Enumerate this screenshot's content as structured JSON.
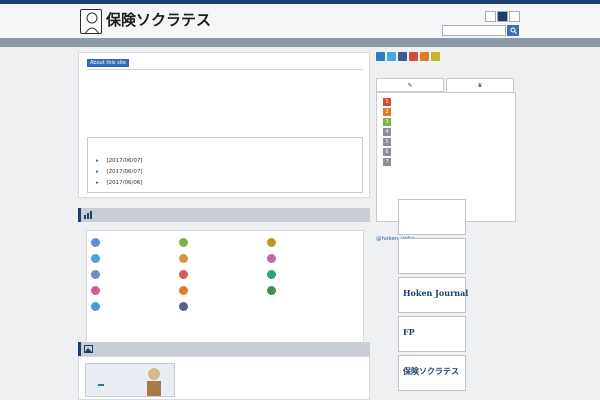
{
  "header": {
    "site_title": "保険ソクラテス",
    "tagline": "",
    "font_size_label": "",
    "font_sizes": [
      "",
      "",
      ""
    ],
    "search_placeholder": ""
  },
  "intro": {
    "badge": "About this site",
    "title": "",
    "paragraph1": "",
    "paragraph2": ""
  },
  "news": {
    "heading": "",
    "items": [
      {
        "category": "",
        "title": "",
        "date": "[2017/06/07]"
      },
      {
        "category": "",
        "title": "",
        "date": "[2017/06/07]"
      },
      {
        "category": "",
        "title": "",
        "date": "[2017/06/06]"
      }
    ]
  },
  "categories": {
    "heading": "",
    "items": [
      {
        "label": "",
        "color": "#5b8fd6"
      },
      {
        "label": "",
        "color": "#7bb34a"
      },
      {
        "label": "",
        "color": "#b89a2a"
      },
      {
        "label": "",
        "color": "#4aa3d6"
      },
      {
        "label": "",
        "color": "#d6904a"
      },
      {
        "label": "",
        "color": "#c06aa0"
      },
      {
        "label": "",
        "color": "#6b8fc2"
      },
      {
        "label": "",
        "color": "#d65b5b"
      },
      {
        "label": "",
        "color": "#2fa37a"
      },
      {
        "label": "",
        "color": "#d65b8a"
      },
      {
        "label": "",
        "color": "#e07b2a"
      },
      {
        "label": "",
        "color": "#3d8f5a"
      },
      {
        "label": "",
        "color": "#4a9ad6"
      },
      {
        "label": "",
        "color": "#5a5f8a"
      }
    ]
  },
  "glossary": {
    "heading": "",
    "banner_label": "",
    "title": "",
    "text_highlight": "",
    "text_rest": ""
  },
  "sidebar": {
    "social": [
      {
        "name": "hatena-icon",
        "color": "#2f7bc2"
      },
      {
        "name": "twitter-icon",
        "color": "#4aa8e0"
      },
      {
        "name": "facebook-icon",
        "color": "#3b5998"
      },
      {
        "name": "google-plus-icon",
        "color": "#d64a3a"
      },
      {
        "name": "pocket-icon",
        "color": "#e07b2a"
      },
      {
        "name": "feedly-icon",
        "color": "#c9b52c"
      }
    ],
    "tabs": [
      "",
      ""
    ],
    "ranking": [
      {
        "num": "1",
        "text": "",
        "color": "#d64a3a"
      },
      {
        "num": "2",
        "text": "",
        "color": "#e07b2a"
      },
      {
        "num": "3",
        "text": "",
        "color": "#7bb34a"
      },
      {
        "num": "4",
        "text": "",
        "color": "#8a8f96"
      },
      {
        "num": "5",
        "text": "",
        "color": "#8a8f96"
      },
      {
        "num": "6",
        "text": "",
        "color": "#8a8f96"
      },
      {
        "num": "7",
        "text": "",
        "color": "#8a8f96"
      }
    ],
    "twitter_line": "@hoken_iroha",
    "banners": [
      {
        "title": "",
        "sub": ""
      },
      {
        "title": "",
        "sub": ""
      },
      {
        "title": "Hoken Journal",
        "sub": ""
      },
      {
        "title": "FP",
        "sub": ""
      },
      {
        "title": "保険ソクラテス",
        "sub": ""
      }
    ]
  }
}
